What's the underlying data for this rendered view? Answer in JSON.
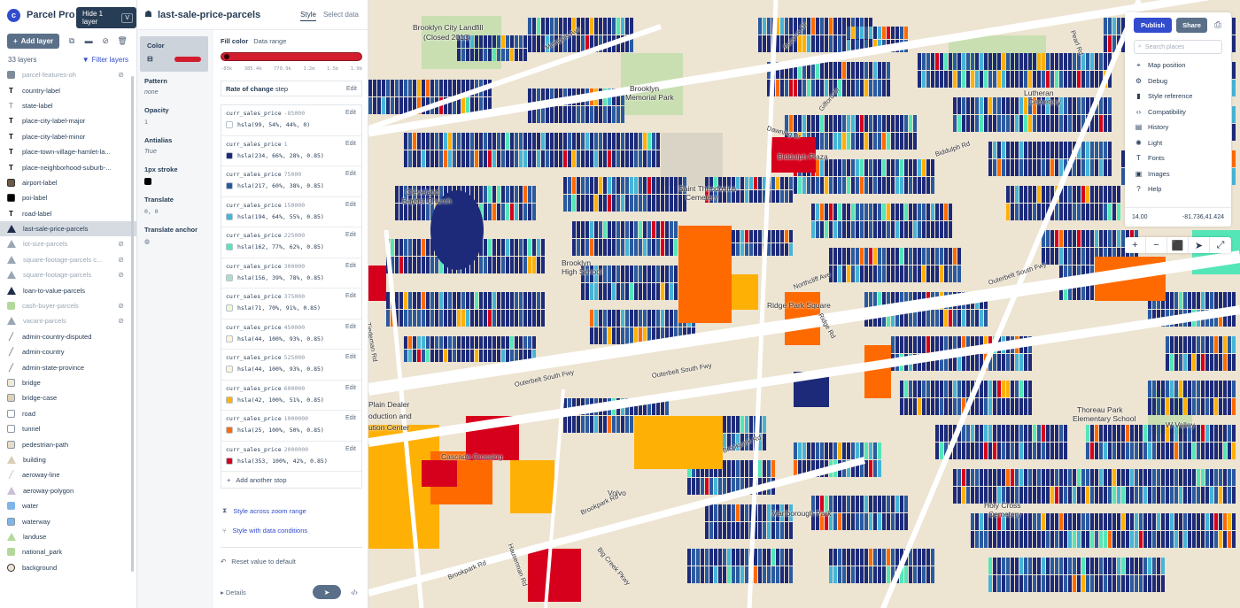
{
  "app": {
    "name": "Parcel Pro",
    "logo_glyph": "c"
  },
  "tooltip": {
    "text": "Hide 1 layer",
    "key": "V"
  },
  "toolbar": {
    "add_label": "Add layer"
  },
  "layers_meta": {
    "count": "33 layers",
    "filter_label": "Filter layers"
  },
  "layers": [
    {
      "name": "parcel-features-oh",
      "icon": "fill",
      "color": "#7d8b99",
      "hidden": true
    },
    {
      "name": "country-label",
      "icon": "symbol",
      "color": "#000000",
      "hidden": false
    },
    {
      "name": "state-label",
      "icon": "symbol",
      "color": "#9aa29a",
      "hidden": false
    },
    {
      "name": "place-city-label-major",
      "icon": "symbol",
      "color": "#000000",
      "hidden": false
    },
    {
      "name": "place-city-label-minor",
      "icon": "symbol",
      "color": "#000000",
      "hidden": false
    },
    {
      "name": "place-town-village-hamlet-la...",
      "icon": "symbol",
      "color": "#000000",
      "hidden": false
    },
    {
      "name": "place-neighborhood-suburb-...",
      "icon": "symbol",
      "color": "#000000",
      "hidden": false
    },
    {
      "name": "airport-label",
      "icon": "poi",
      "color": "#6b5a46",
      "hidden": false
    },
    {
      "name": "poi-label",
      "icon": "poi",
      "color": "#000000",
      "hidden": false
    },
    {
      "name": "road-label",
      "icon": "symbol",
      "color": "#000000",
      "hidden": false
    },
    {
      "name": "last-sale-price-parcels",
      "icon": "fill-extrusion",
      "color": "#1f2d4a",
      "hidden": false,
      "selected": true
    },
    {
      "name": "lot-size-parcels",
      "icon": "fill-extrusion",
      "color": "#9aa6b4",
      "hidden": true
    },
    {
      "name": "square-footage-parcels c...",
      "icon": "fill-extrusion",
      "color": "#9aa6b4",
      "hidden": true
    },
    {
      "name": "square-footage-parcels",
      "icon": "fill-extrusion",
      "color": "#9aa6b4",
      "hidden": true
    },
    {
      "name": "loan-to-value-parcels",
      "icon": "fill-extrusion",
      "color": "#1f2d4a",
      "hidden": false
    },
    {
      "name": "cash-buyer-parcels",
      "icon": "fill",
      "color": "#b4d89c",
      "hidden": true
    },
    {
      "name": "vacant-parcels",
      "icon": "fill-extrusion",
      "color": "#9aa6b4",
      "hidden": true
    },
    {
      "name": "admin-country-disputed",
      "icon": "line",
      "color": "#7d8b99",
      "hidden": false
    },
    {
      "name": "admin-country",
      "icon": "line",
      "color": "#7d8b99",
      "hidden": false
    },
    {
      "name": "admin-state-province",
      "icon": "line",
      "color": "#7d8b99",
      "hidden": false
    },
    {
      "name": "bridge",
      "icon": "line-box",
      "color": "#f1e9d6",
      "hidden": false
    },
    {
      "name": "bridge-case",
      "icon": "line-box",
      "color": "#dfd2b6",
      "hidden": false
    },
    {
      "name": "road",
      "icon": "line-box",
      "color": "#ffffff",
      "hidden": false
    },
    {
      "name": "tunnel",
      "icon": "line-box",
      "color": "#ffffff",
      "hidden": false
    },
    {
      "name": "pedestrian-path",
      "icon": "line-box",
      "color": "#e6dcc8",
      "hidden": false
    },
    {
      "name": "building",
      "icon": "fill-extrusion",
      "color": "#d8ceb8",
      "hidden": false
    },
    {
      "name": "aeroway-line",
      "icon": "line",
      "color": "#c8c0d6",
      "hidden": false
    },
    {
      "name": "aeroway-polygon",
      "icon": "fill-extrusion",
      "color": "#c8c0d6",
      "hidden": false
    },
    {
      "name": "water",
      "icon": "fill",
      "color": "#7fb5e8",
      "hidden": false
    },
    {
      "name": "waterway",
      "icon": "line-box",
      "color": "#7fb5e8",
      "hidden": false
    },
    {
      "name": "landuse",
      "icon": "fill-extrusion",
      "color": "#b4d89c",
      "hidden": false
    },
    {
      "name": "national_park",
      "icon": "fill",
      "color": "#b4d89c",
      "hidden": false
    },
    {
      "name": "background",
      "icon": "background",
      "color": "#ede4d2",
      "hidden": false
    }
  ],
  "editor": {
    "title": "last-sale-price-parcels",
    "tab_style": "Style",
    "tab_select": "Select data",
    "properties": [
      {
        "label": "Color",
        "value": "",
        "active": true
      },
      {
        "label": "Pattern",
        "value": "none"
      },
      {
        "label": "Opacity",
        "value": "1"
      },
      {
        "label": "Antialias",
        "value": "True"
      },
      {
        "label": "1px stroke",
        "value": ""
      },
      {
        "label": "Translate",
        "value": "0, 0"
      },
      {
        "label": "Translate anchor",
        "value": ""
      }
    ],
    "fill_color_label": "Fill color",
    "data_range_label": "Data range",
    "ramp_ticks": [
      "-85k",
      "385.4k",
      "770.9k",
      "1.2m",
      "1.5b",
      "1.9b"
    ],
    "rate_of_change": "Rate of change",
    "rate_type": "step",
    "edit_label": "Edit",
    "stops": [
      {
        "key": "curr_sales_price",
        "value": "-85000",
        "color": "hsla(99, 54%, 44%, 0)",
        "swatch": "#ffffff"
      },
      {
        "key": "curr_sales_price",
        "value": "1",
        "color": "hsla(234, 66%, 28%, 0.85)",
        "swatch": "#1c2a79"
      },
      {
        "key": "curr_sales_price",
        "value": "75000",
        "color": "hsla(217, 60%, 38%, 0.85)",
        "swatch": "#2a5aa0"
      },
      {
        "key": "curr_sales_price",
        "value": "150000",
        "color": "hsla(194, 64%, 55%, 0.85)",
        "swatch": "#46b4d6"
      },
      {
        "key": "curr_sales_price",
        "value": "225000",
        "color": "hsla(162, 77%, 62%, 0.85)",
        "swatch": "#55e6b8"
      },
      {
        "key": "curr_sales_price",
        "value": "300000",
        "color": "hsla(156, 39%, 78%, 0.85)",
        "swatch": "#b2dcc8"
      },
      {
        "key": "curr_sales_price",
        "value": "375000",
        "color": "hsla(71, 70%, 91%, 0.85)",
        "swatch": "#f2f7d4"
      },
      {
        "key": "curr_sales_price",
        "value": "450000",
        "color": "hsla(44, 100%, 93%, 0.85)",
        "swatch": "#fff4da"
      },
      {
        "key": "curr_sales_price",
        "value": "525000",
        "color": "hsla(44, 100%, 93%, 0.85)",
        "swatch": "#fff4da"
      },
      {
        "key": "curr_sales_price",
        "value": "600000",
        "color": "hsla(42, 100%, 51%, 0.85)",
        "swatch": "#ffb005"
      },
      {
        "key": "curr_sales_price",
        "value": "1000000",
        "color": "hsla(25, 100%, 50%, 0.85)",
        "swatch": "#ff6a00"
      },
      {
        "key": "curr_sales_price",
        "value": "2000000",
        "color": "hsla(353, 100%, 42%, 0.85)",
        "swatch": "#d6001c"
      }
    ],
    "add_stop": "Add another stop",
    "zoom_range": "Style across zoom range",
    "data_conditions": "Style with data conditions",
    "reset": "Reset value to default",
    "details": "Details"
  },
  "map_labels": [
    {
      "text": "Brooklyn City Landfill",
      "kind": "poi"
    },
    {
      "text": "(Closed 2013)",
      "kind": "poi"
    },
    {
      "text": "Memphis Ave",
      "kind": "road"
    },
    {
      "text": "Brooklyn",
      "kind": "poi"
    },
    {
      "text": "Memorial Park",
      "kind": "poi"
    },
    {
      "text": "Biddulph Plaza",
      "kind": "poi"
    },
    {
      "text": "Saint Theodosius",
      "kind": "poi"
    },
    {
      "text": "Cemetery",
      "kind": "poi"
    },
    {
      "text": "Cleveland",
      "kind": "poi"
    },
    {
      "text": "Baptist Church",
      "kind": "poi"
    },
    {
      "text": "Brooklyn",
      "kind": "poi"
    },
    {
      "text": "High School",
      "kind": "poi"
    },
    {
      "text": "Ridge Park Square",
      "kind": "poi"
    },
    {
      "text": "Outerbelt South Fwy",
      "kind": "road"
    },
    {
      "text": "Outerbelt South Fwy",
      "kind": "road"
    },
    {
      "text": "Outerbelt South Fwy",
      "kind": "road"
    },
    {
      "text": "Plain Dealer",
      "kind": "poi"
    },
    {
      "text": "oduction and",
      "kind": "poi"
    },
    {
      "text": "ution Center",
      "kind": "poi"
    },
    {
      "text": "Cascade Crossing",
      "kind": "poi"
    },
    {
      "text": "Volvo",
      "kind": "poi"
    },
    {
      "text": "Marlborough Park",
      "kind": "poi"
    },
    {
      "text": "Brookpark Rd",
      "kind": "road"
    },
    {
      "text": "Brookpark Rd",
      "kind": "road"
    },
    {
      "text": "Brookpark Rd",
      "kind": "road"
    },
    {
      "text": "Holy Cross",
      "kind": "poi"
    },
    {
      "text": "Cemetery",
      "kind": "poi"
    },
    {
      "text": "Thoreau Park",
      "kind": "poi"
    },
    {
      "text": "Elementary School",
      "kind": "poi"
    },
    {
      "text": "Lutheran",
      "kind": "poi"
    },
    {
      "text": "Cemetery",
      "kind": "poi"
    },
    {
      "text": "Biddulph Rd",
      "kind": "road"
    },
    {
      "text": "Big Creek Pkwy",
      "kind": "road"
    },
    {
      "text": "Dawning Dr",
      "kind": "road"
    },
    {
      "text": "Northcliff Ave",
      "kind": "road"
    },
    {
      "text": "Tiedeman Rd",
      "kind": "road"
    },
    {
      "text": "Hauserman Rd",
      "kind": "road"
    },
    {
      "text": "Ridge Rd",
      "kind": "road"
    },
    {
      "text": "Pearl Rd",
      "kind": "road"
    },
    {
      "text": "W Valley",
      "kind": "poi"
    },
    {
      "text": "Gifford Dr",
      "kind": "road"
    },
    {
      "text": "Bucyrus Dr",
      "kind": "road"
    }
  ],
  "tools": {
    "publish": "Publish",
    "share": "Share",
    "search_placeholder": "Search places",
    "items": [
      {
        "label": "Map position",
        "icon": "target-icon",
        "glyph": "⌖"
      },
      {
        "label": "Debug",
        "icon": "bug-icon",
        "glyph": "⚙"
      },
      {
        "label": "Style reference",
        "icon": "book-icon",
        "glyph": "▮"
      },
      {
        "label": "Compatibility",
        "icon": "code-icon",
        "glyph": "‹›"
      },
      {
        "label": "History",
        "icon": "history-icon",
        "glyph": "▤"
      },
      {
        "label": "Light",
        "icon": "sun-icon",
        "glyph": "✺"
      },
      {
        "label": "Fonts",
        "icon": "font-icon",
        "glyph": "T"
      },
      {
        "label": "Images",
        "icon": "image-icon",
        "glyph": "▣"
      },
      {
        "label": "Help",
        "icon": "help-icon",
        "glyph": "?"
      }
    ],
    "zoom": "14.00",
    "coords": "-81.736,41.424"
  },
  "map_controls": [
    {
      "label": "+",
      "icon": "zoom-in-icon"
    },
    {
      "label": "−",
      "icon": "zoom-out-icon"
    },
    {
      "label": "⬛",
      "icon": "lock-icon"
    },
    {
      "label": "➤",
      "icon": "pointer-icon"
    },
    {
      "label": "⤢",
      "icon": "fullscreen-icon"
    }
  ]
}
